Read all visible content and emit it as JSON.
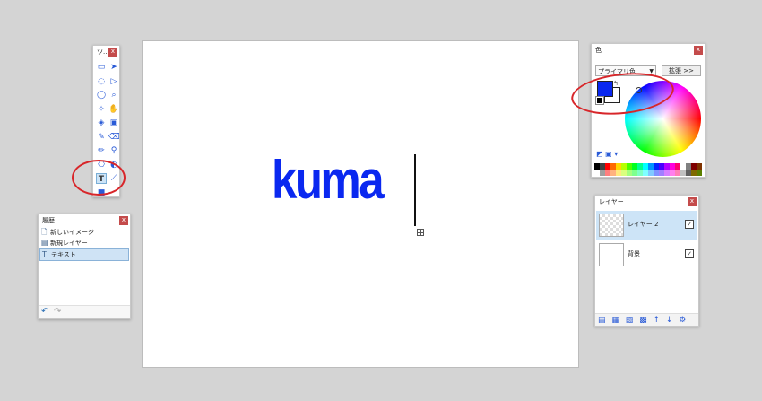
{
  "canvas": {
    "text": "kuma",
    "text_color": "#0a28f0"
  },
  "tools": {
    "title": "ツ...",
    "close": "x",
    "items": [
      {
        "name": "rectangle-select-icon",
        "glyph": "▭"
      },
      {
        "name": "move-selected-icon",
        "glyph": "➤"
      },
      {
        "name": "lasso-select-icon",
        "glyph": "◌"
      },
      {
        "name": "move-selection-icon",
        "glyph": "▷"
      },
      {
        "name": "ellipse-select-icon",
        "glyph": "◯"
      },
      {
        "name": "zoom-icon",
        "glyph": "⌕"
      },
      {
        "name": "magic-wand-icon",
        "glyph": "✧"
      },
      {
        "name": "pan-icon",
        "glyph": "✋"
      },
      {
        "name": "paint-bucket-icon",
        "glyph": "◈"
      },
      {
        "name": "gradient-icon",
        "glyph": "▣"
      },
      {
        "name": "paintbrush-icon",
        "glyph": "✎"
      },
      {
        "name": "eraser-icon",
        "glyph": "⌫"
      },
      {
        "name": "pencil-icon",
        "glyph": "✏"
      },
      {
        "name": "color-picker-icon",
        "glyph": "⚲"
      },
      {
        "name": "clone-stamp-icon",
        "glyph": "⎔"
      },
      {
        "name": "recolor-icon",
        "glyph": "◐"
      },
      {
        "name": "text-tool-icon",
        "glyph": "T",
        "active": true
      },
      {
        "name": "line-curve-icon",
        "glyph": "⟋"
      },
      {
        "name": "shapes-icon",
        "glyph": "■"
      }
    ]
  },
  "history": {
    "title": "履歴",
    "close": "x",
    "items": [
      {
        "label": "新しいイメージ",
        "icon": "new-image-icon",
        "glyph": "🗋"
      },
      {
        "label": "新規レイヤー",
        "icon": "new-layer-icon",
        "glyph": "▤"
      },
      {
        "label": "テキスト",
        "icon": "text-icon",
        "glyph": "T",
        "selected": true
      }
    ],
    "undo_glyph": "↶",
    "redo_glyph": "↷"
  },
  "colors": {
    "title": "色",
    "close": "x",
    "mode_select": "プライマリ色",
    "expand_button": "拡張 >>",
    "primary": "#0a28f0",
    "secondary": "#ffffff",
    "palette": [
      "#000000",
      "#404040",
      "#ff0000",
      "#ff6a00",
      "#ffd800",
      "#b6ff00",
      "#4cff00",
      "#00ff21",
      "#00ff90",
      "#00ffff",
      "#0094ff",
      "#0026ff",
      "#4800ff",
      "#b200ff",
      "#ff00dc",
      "#ff006e",
      "#ffffff",
      "#808080",
      "#7f0000",
      "#7f3300",
      "#ffffff",
      "#a0a0a0",
      "#ff7f7f",
      "#ffb27f",
      "#ffe97f",
      "#daff7f",
      "#a5ff7f",
      "#7fff8e",
      "#7fffc5",
      "#7fffff",
      "#7fc9ff",
      "#7f92ff",
      "#a17fff",
      "#d67fff",
      "#ff7fed",
      "#ff7fb6",
      "#c0c0c0",
      "#606060",
      "#7f6a00",
      "#5b7f00"
    ]
  },
  "layers": {
    "title": "レイヤー",
    "close": "x",
    "items": [
      {
        "name": "レイヤー 2",
        "visible": "✓",
        "selected": true
      },
      {
        "name": "背景",
        "visible": "✓",
        "selected": false
      }
    ],
    "footer_icons": [
      "add-layer-icon",
      "delete-layer-icon",
      "duplicate-layer-icon",
      "merge-layer-icon",
      "move-up-icon",
      "move-down-icon",
      "layer-properties-icon"
    ],
    "footer_glyphs": "▤ ▦ ▧ ▩ ↑ ↓ ⚙"
  },
  "annotation_color": "#d8262a"
}
